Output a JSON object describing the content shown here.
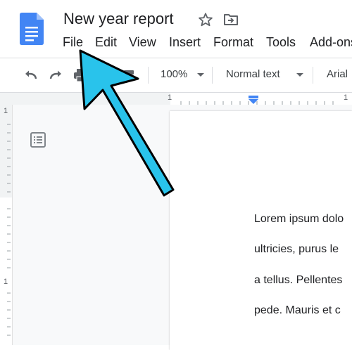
{
  "document": {
    "title": "New year report"
  },
  "menu": [
    "File",
    "Edit",
    "View",
    "Insert",
    "Format",
    "Tools",
    "Add-ons"
  ],
  "toolbar": {
    "zoom": "100%",
    "style": "Normal text",
    "font": "Arial"
  },
  "rulers": {
    "horizontal_marks": [
      "1",
      "1"
    ],
    "vertical_marks": [
      "1",
      "1"
    ]
  },
  "body": {
    "lines": [
      "Lorem ipsum dolo",
      "ultricies, purus le",
      "a tellus. Pellentes",
      "pede. Mauris et c"
    ]
  },
  "icons": [
    "docs-logo-icon",
    "star-icon",
    "move-to-folder-icon",
    "undo-icon",
    "redo-icon",
    "print-icon",
    "paint-format-icon",
    "outline-icon",
    "indent-marker-icon",
    "pointer-arrow"
  ],
  "colors": {
    "docs_blue": "#4285f4",
    "arrow_fill": "#29c3eb",
    "text": "#202124"
  }
}
